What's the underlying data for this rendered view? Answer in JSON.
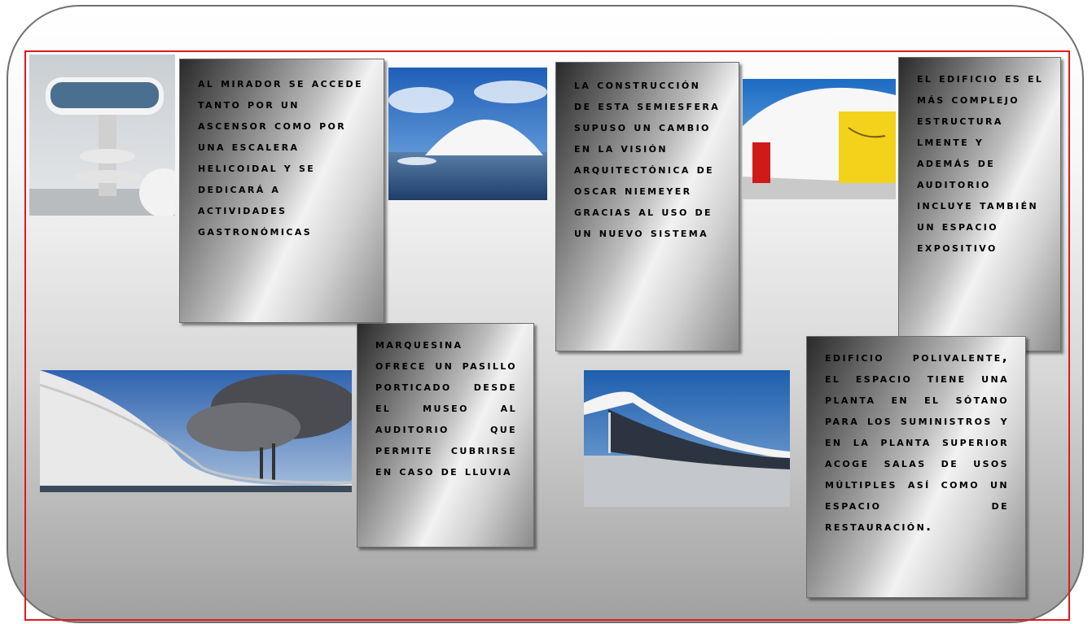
{
  "cards": {
    "mirador": "Al mirador se accede tanto por un ascensor como por una escalera helicoidal y se dedicará a actividades gastronómicas",
    "semiesfera": "La construcción de esta semiesfera supuso un cambio en la visión arquitectónica de Oscar Niemeyer gracias al uso de un nuevo sistema",
    "edificio": "El edificio es el más complejo estructura lmente y además de auditorio incluye también un espacio expositivo",
    "marquesina": "Marquesina ofrece un pasillo porticado desde el museo al auditorio que permite cubrirse en caso de lluvia",
    "polivalente": "Edificio polivalente, el espacio tiene una planta en el sótano para los suministros y en la planta superior acoge salas de usos múltiples así como un espacio de restauración."
  },
  "photos": {
    "tower": "tower-photo",
    "dome": "dome-photo",
    "auditorium": "auditorium-photo",
    "canopy": "canopy-photo",
    "building": "building-photo"
  },
  "colors": {
    "frame_red": "#e0191b",
    "outer_border": "#6f6f6f"
  }
}
